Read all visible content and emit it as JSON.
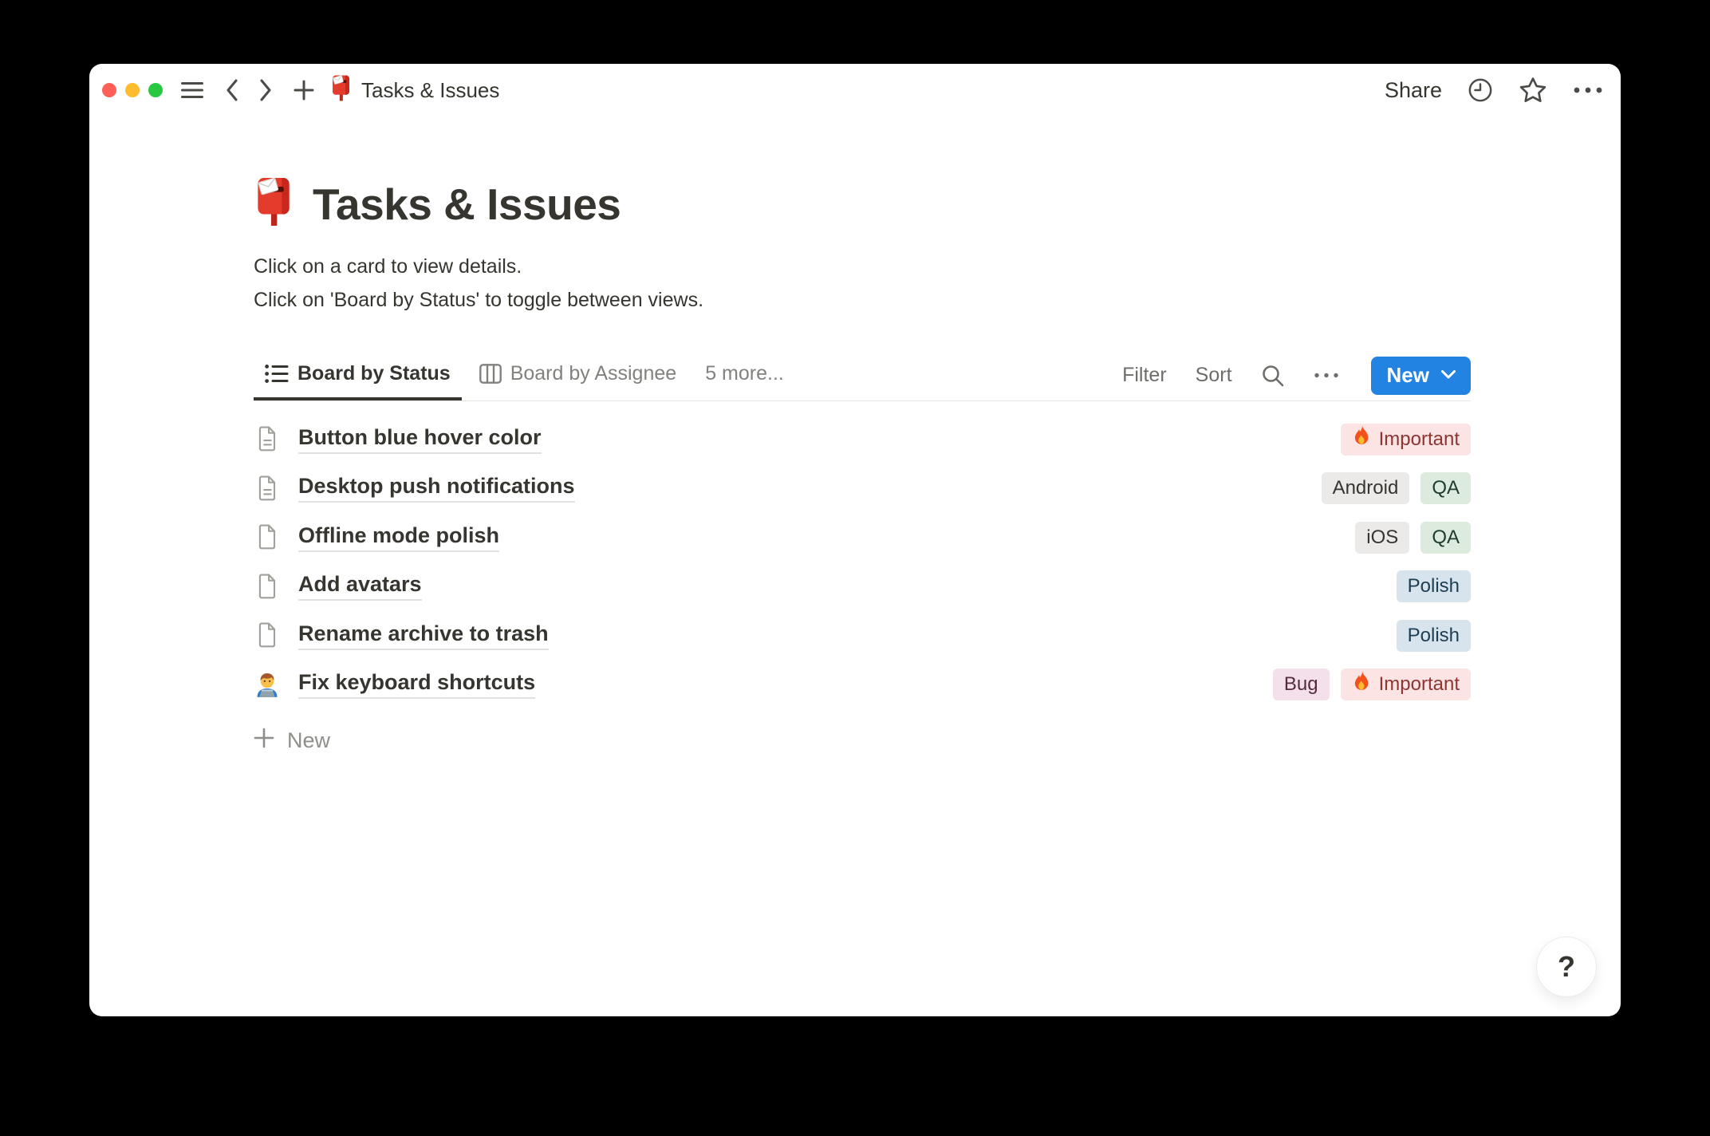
{
  "titlebar": {
    "title": "Tasks & Issues",
    "share_label": "Share"
  },
  "page": {
    "title": "Tasks & Issues",
    "description_lines": [
      "Click on a card to view details.",
      "Click on 'Board by Status' to toggle between views."
    ]
  },
  "views": {
    "tabs": [
      {
        "label": "Board by Status",
        "icon": "list-view-icon",
        "active": true
      },
      {
        "label": "Board by Assignee",
        "icon": "board-view-icon",
        "active": false
      },
      {
        "label": "5 more...",
        "active": false
      }
    ],
    "toolbar": {
      "filter_label": "Filter",
      "sort_label": "Sort",
      "new_label": "New"
    }
  },
  "items": [
    {
      "icon": "page-text-icon",
      "title": "Button blue hover color",
      "tags": [
        {
          "label": "Important",
          "color": "red",
          "fire": true
        }
      ]
    },
    {
      "icon": "page-text-icon",
      "title": "Desktop push notifications",
      "tags": [
        {
          "label": "Android",
          "color": "gray"
        },
        {
          "label": "QA",
          "color": "green"
        }
      ]
    },
    {
      "icon": "page-blank-icon",
      "title": "Offline mode polish",
      "tags": [
        {
          "label": "iOS",
          "color": "gray"
        },
        {
          "label": "QA",
          "color": "green"
        }
      ]
    },
    {
      "icon": "page-blank-icon",
      "title": "Add avatars",
      "tags": [
        {
          "label": "Polish",
          "color": "blue"
        }
      ]
    },
    {
      "icon": "page-blank-icon",
      "title": "Rename archive to trash",
      "tags": [
        {
          "label": "Polish",
          "color": "blue"
        }
      ]
    },
    {
      "icon": "technologist-emoji-icon",
      "title": "Fix keyboard shortcuts",
      "tags": [
        {
          "label": "Bug",
          "color": "pink"
        },
        {
          "label": "Important",
          "color": "red",
          "fire": true
        }
      ]
    }
  ],
  "new_row_label": "New",
  "help_label": "?",
  "colors": {
    "accent_blue": "#2383e2",
    "text_primary": "#37352f",
    "text_secondary": "#83817d",
    "tag_red_bg": "#fbe4e3",
    "tag_red_text": "#8f3430",
    "tag_gray_bg": "#ebeae8",
    "tag_gray_text": "#373530",
    "tag_green_bg": "#dcebdd",
    "tag_green_text": "#1f3d2f",
    "tag_blue_bg": "#d7e4ee",
    "tag_blue_text": "#1c3d52",
    "tag_pink_bg": "#f4e0eb",
    "tag_pink_text": "#542b3f",
    "traffic_red": "#ff5f57",
    "traffic_yellow": "#febc2e",
    "traffic_green": "#28c840"
  }
}
